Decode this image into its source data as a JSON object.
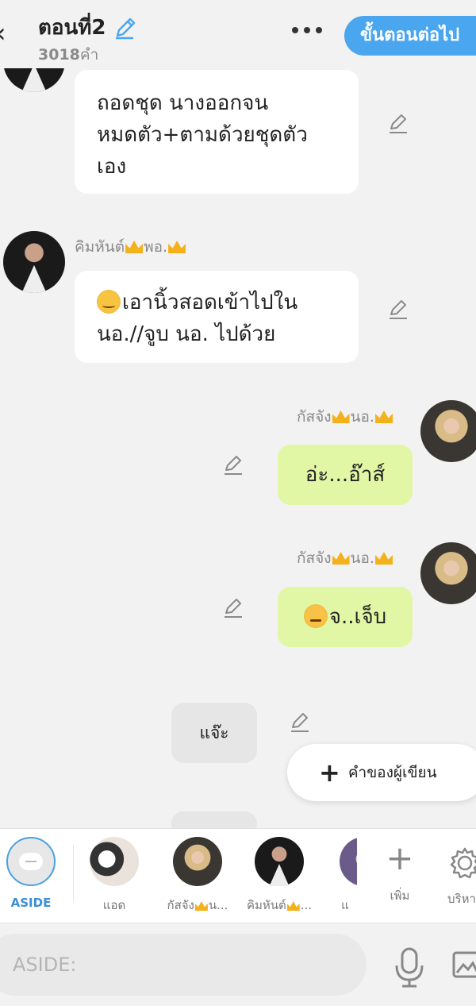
{
  "header": {
    "back_icon": "chevron-left-icon",
    "title": "ตอนที่2",
    "word_count": "3018",
    "word_unit": "คำ",
    "next_button": "ขั้นตอนต่อไป",
    "accent": "#4aa6ee"
  },
  "messages": [
    {
      "side": "left",
      "text": "ถอดชุด นางออกจนหมดตัว+ตามด้วยชุดตัวเอง"
    },
    {
      "side": "left",
      "name_a": "คิมหันต์",
      "name_b": "พอ.",
      "text": "เอานิ้วสอดเข้าไปในนอ.//จูบ นอ. ไปด้วย"
    },
    {
      "side": "right",
      "name_a": "กัสจัง",
      "name_b": "นอ.",
      "text": "อ่ะ...อ๊าส์"
    },
    {
      "side": "right",
      "name_a": "กัสจัง",
      "name_b": "นอ.",
      "text": "จ..เจ็บ"
    },
    {
      "side": "aside",
      "text": "แจ๊ะ"
    }
  ],
  "writer_note_button": "คำของผู้เขียน",
  "characters": [
    {
      "label": "ASIDE"
    },
    {
      "label": "แอด"
    },
    {
      "label": "กัสจัง",
      "suffix": "น..."
    },
    {
      "label": "คิมหันต์",
      "suffix": "..."
    },
    {
      "label": "แ"
    }
  ],
  "tools": [
    {
      "label": "เพิ่ม",
      "icon": "plus-icon"
    },
    {
      "label": "บริหาร",
      "icon": "gear-icon"
    }
  ],
  "input": {
    "placeholder": "ASIDE:"
  },
  "colors": {
    "green_bubble": "#e1f7a5",
    "background": "#f2f2f2"
  }
}
